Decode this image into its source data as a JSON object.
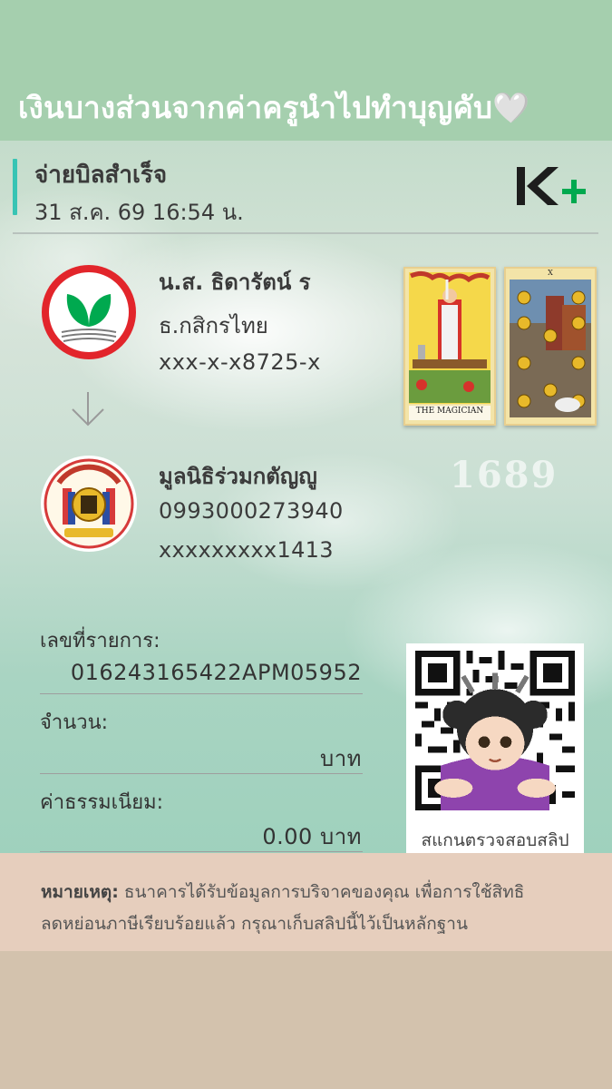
{
  "banner": {
    "text": "เงินบางส่วนจากค่าครูนำไปทำบุญคับ🤍"
  },
  "slip": {
    "title": "จ่ายบิลสำเร็จ",
    "datetime": "31 ส.ค. 69  16:54 น.",
    "app_logo_icon": "kplus-logo-icon"
  },
  "from": {
    "name": "น.ส. ธิดารัตน์ ร",
    "bank": "ธ.กสิกรไทย",
    "account": "xxx-x-x8725-x"
  },
  "to": {
    "name": "มูลนิธิร่วมกตัญญู",
    "tax_id": "0993000273940",
    "account": "xxxxxxxxx1413"
  },
  "sticker": {
    "tarot_card_1": "THE MAGICIAN",
    "tarot_card_2_number": "X",
    "number": "1689"
  },
  "details": {
    "ref_label": "เลขที่รายการ:",
    "ref_value": "016243165422APM05952",
    "amount_label": "จำนวน:",
    "amount_value": "บาท",
    "fee_label": "ค่าธรรมเนียม:",
    "fee_value": "0.00 บาท"
  },
  "qr": {
    "caption": "สแกนตรวจสอบสลิป"
  },
  "note": {
    "label": "หมายเหตุ:",
    "line1": " ธนาคารได้รับข้อมูลการบริจาคของคุณ เพื่อการใช้สิทธิ",
    "line2": "ลดหย่อนภาษีเรียบร้อยแล้ว กรุณาเก็บสลิปนี้ไว้เป็นหลักฐาน"
  },
  "colors": {
    "banner": "#a5cfae",
    "accent": "#38c4b4",
    "kbank_green": "#00a94f",
    "kbank_red": "#e2252b",
    "note_bg": "#e6cebd",
    "bottom_bg": "#d3c2ad"
  }
}
